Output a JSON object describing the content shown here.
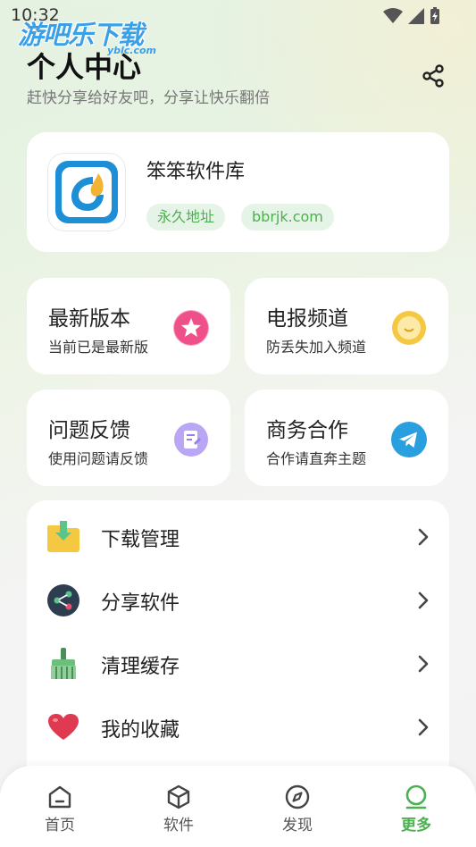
{
  "status_bar": {
    "time": "10:32"
  },
  "watermark": {
    "text": "游吧乐下载",
    "sub": "yblc.com"
  },
  "header": {
    "title": "个人中心",
    "subtitle": "赶快分享给好友吧，分享让快乐翻倍"
  },
  "app_card": {
    "name": "笨笨软件库",
    "tags": [
      "永久地址",
      "bbrjk.com"
    ]
  },
  "grid": [
    {
      "title": "最新版本",
      "subtitle": "当前已是最新版",
      "icon": "star-badge-icon",
      "color": "#f0508a"
    },
    {
      "title": "电报频道",
      "subtitle": "防丢失加入频道",
      "icon": "smile-icon",
      "color": "#f5c842"
    },
    {
      "title": "问题反馈",
      "subtitle": "使用问题请反馈",
      "icon": "feedback-icon",
      "color": "#9a7ef0"
    },
    {
      "title": "商务合作",
      "subtitle": "合作请直奔主题",
      "icon": "telegram-icon",
      "color": "#2a9fe0"
    }
  ],
  "list": [
    {
      "label": "下载管理",
      "icon": "download-folder-icon"
    },
    {
      "label": "分享软件",
      "icon": "share-circle-icon"
    },
    {
      "label": "清理缓存",
      "icon": "broom-icon"
    },
    {
      "label": "我的收藏",
      "icon": "heart-icon"
    }
  ],
  "bottom_nav": [
    {
      "label": "首页",
      "icon": "home-icon"
    },
    {
      "label": "软件",
      "icon": "cube-icon"
    },
    {
      "label": "发现",
      "icon": "compass-icon"
    },
    {
      "label": "更多",
      "icon": "more-icon",
      "active": true
    }
  ],
  "colors": {
    "accent": "#4caf50",
    "tag_bg": "#e6f4e8"
  }
}
